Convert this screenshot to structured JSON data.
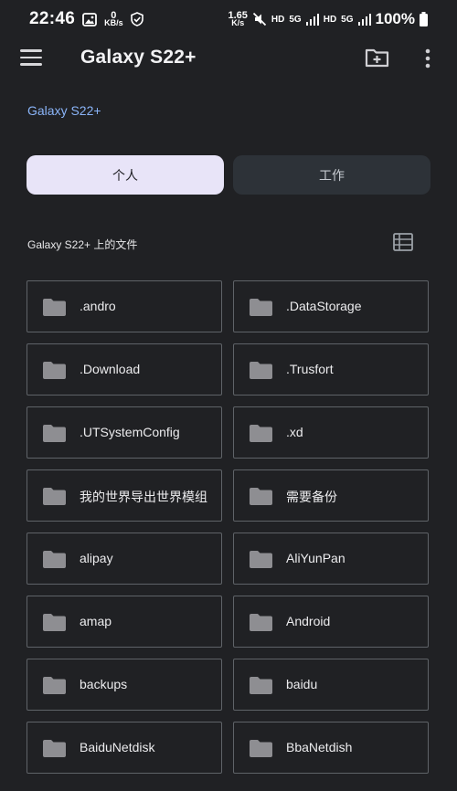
{
  "status_bar": {
    "time": "22:46",
    "data_speed_left_value": "0",
    "data_speed_left_unit": "KB/s",
    "data_speed_right_value": "1.65",
    "data_speed_right_unit": "K/s",
    "hd_label_1": "HD",
    "network_1": "5G",
    "hd_label_2": "HD",
    "network_2": "5G",
    "battery": "100%"
  },
  "app_bar": {
    "title": "Galaxy S22+",
    "menu_icon": "hamburger-menu-icon",
    "new_folder_icon": "new-folder-icon",
    "more_icon": "more-vert-icon"
  },
  "breadcrumb": "Galaxy S22+",
  "tabs": [
    {
      "label": "个人",
      "selected": true
    },
    {
      "label": "工作",
      "selected": false
    }
  ],
  "section": {
    "label": "Galaxy S22+ 上的文件",
    "view_toggle_icon": "list-view-icon"
  },
  "folders": [
    {
      "name": ".andro"
    },
    {
      "name": ".DataStorage"
    },
    {
      "name": ".Download"
    },
    {
      "name": ".Trusfort"
    },
    {
      "name": ".UTSystemConfig"
    },
    {
      "name": ".xd"
    },
    {
      "name": "我的世界导出世界模组"
    },
    {
      "name": "需要备份"
    },
    {
      "name": "alipay"
    },
    {
      "name": "AliYunPan"
    },
    {
      "name": "amap"
    },
    {
      "name": "Android"
    },
    {
      "name": "backups"
    },
    {
      "name": "baidu"
    },
    {
      "name": "BaiduNetdisk"
    },
    {
      "name": "BbaNetdish"
    }
  ],
  "colors": {
    "background": "#202124",
    "accent_link": "#8ab4f8",
    "tab_selected": "#e8e4f8",
    "tab_unselected": "#2d3238",
    "folder_icon": "#8e8e92"
  }
}
